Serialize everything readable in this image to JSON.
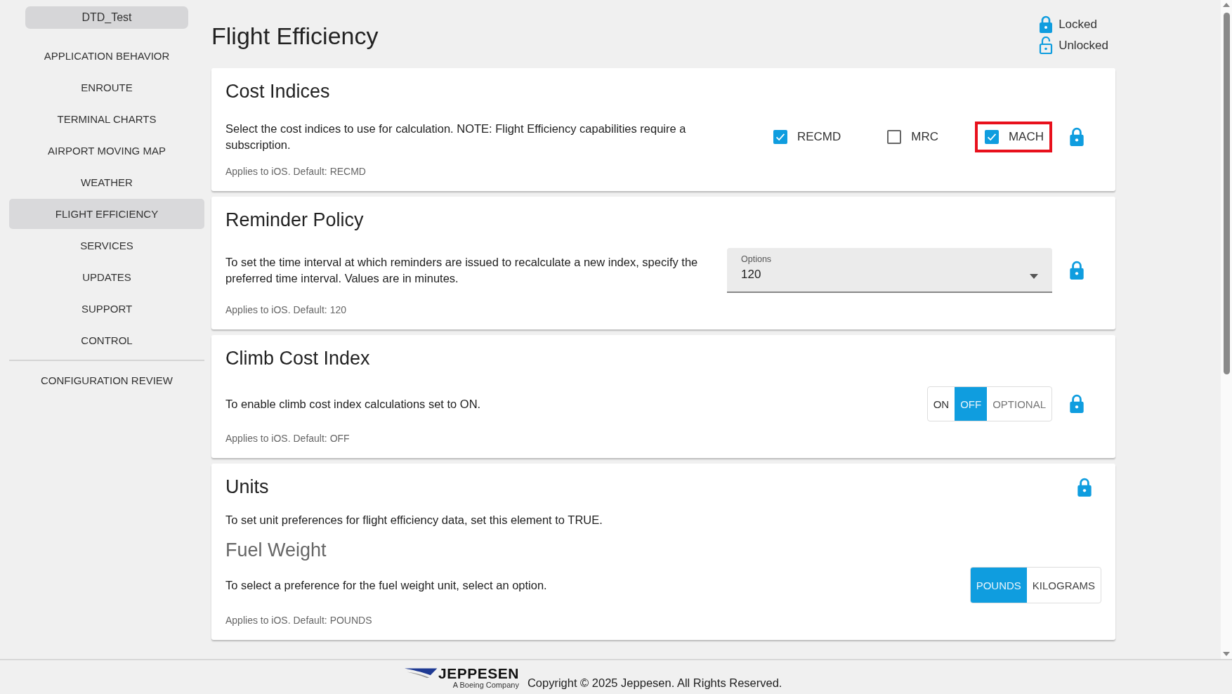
{
  "sidebar": {
    "profile": "DTD_Test",
    "items": [
      {
        "label": "APPLICATION BEHAVIOR",
        "selected": false
      },
      {
        "label": "ENROUTE",
        "selected": false
      },
      {
        "label": "TERMINAL CHARTS",
        "selected": false
      },
      {
        "label": "AIRPORT MOVING MAP",
        "selected": false
      },
      {
        "label": "WEATHER",
        "selected": false
      },
      {
        "label": "FLIGHT EFFICIENCY",
        "selected": true
      },
      {
        "label": "SERVICES",
        "selected": false
      },
      {
        "label": "UPDATES",
        "selected": false
      },
      {
        "label": "SUPPORT",
        "selected": false
      },
      {
        "label": "CONTROL",
        "selected": false
      }
    ],
    "review": "CONFIGURATION REVIEW"
  },
  "page_title": "Flight Efficiency",
  "legend": [
    {
      "label": "Locked",
      "locked": true
    },
    {
      "label": "Unlocked",
      "locked": false
    }
  ],
  "sections": [
    {
      "kind": "checkboxes",
      "title": "Cost Indices",
      "description": "Select the cost indices to use for calculation. NOTE: Flight Efficiency capabilities require a subscription.",
      "note": "Applies to iOS. Default: RECMD",
      "locked": true,
      "options": [
        {
          "label": "RECMD",
          "checked": true,
          "highlighted": false
        },
        {
          "label": "MRC",
          "checked": false,
          "highlighted": false
        },
        {
          "label": "MACH",
          "checked": true,
          "highlighted": true
        }
      ]
    },
    {
      "kind": "select",
      "title": "Reminder Policy",
      "description": "To set the time interval at which reminders are issued to recalculate a new index, specify the preferred time interval. Values are in minutes.",
      "note": "Applies to iOS. Default: 120",
      "locked": true,
      "select": {
        "label": "Options",
        "value": "120"
      }
    },
    {
      "kind": "segmented",
      "title": "Climb Cost Index",
      "description": "To enable climb cost index calculations set to ON.",
      "note": "Applies to iOS. Default: OFF",
      "locked": true,
      "options": [
        {
          "label": "ON",
          "selected": false
        },
        {
          "label": "OFF",
          "selected": true
        },
        {
          "label": "OPTIONAL",
          "selected": false
        }
      ]
    },
    {
      "kind": "group",
      "title": "Units",
      "description": "To set unit preferences for flight efficiency data, set this element to TRUE.",
      "locked": true,
      "subsections": [
        {
          "title": "Fuel Weight",
          "description": "To select a preference for the fuel weight unit, select an option.",
          "note": "Applies to iOS. Default: POUNDS",
          "options": [
            {
              "label": "POUNDS",
              "selected": true
            },
            {
              "label": "KILOGRAMS",
              "selected": false
            }
          ]
        }
      ]
    }
  ],
  "footer": {
    "logo_name": "JEPPESEN",
    "logo_tagline": "A Boeing Company",
    "copyright": "Copyright © 2025 Jeppesen. All Rights Reserved."
  }
}
